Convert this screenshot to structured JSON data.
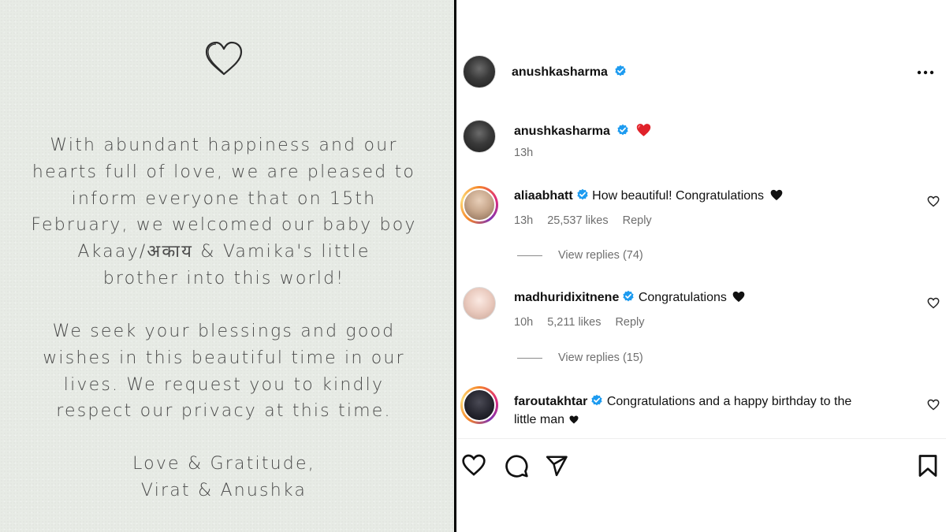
{
  "card": {
    "paragraph1": [
      "With abundant happiness and our",
      "hearts full of love, we are pleased to",
      "inform everyone that on 15th",
      "February, we welcomed our baby boy",
      "Akaay/अकाय & Vamika's little",
      "brother into this world!"
    ],
    "paragraph2": [
      "We seek your blessings and good",
      "wishes in this beautiful time in our",
      "lives. We request you to kindly",
      "respect our privacy at this time."
    ],
    "signoff": [
      "Love & Gratitude,",
      "Virat & Anushka"
    ]
  },
  "post": {
    "author": "anushkasharma",
    "caption_author": "anushkasharma",
    "caption_time": "13h",
    "accent_verified": "#1d9bf0"
  },
  "comments": [
    {
      "user": "aliaabhatt",
      "text": "How beautiful! Congratulations",
      "time": "13h",
      "likes": "25,537 likes",
      "reply": "Reply",
      "view_replies": "View replies (74)"
    },
    {
      "user": "madhuridixitnene",
      "text": "Congratulations",
      "time": "10h",
      "likes": "5,211 likes",
      "reply": "Reply",
      "view_replies": "View replies (15)"
    },
    {
      "user": "faroutakhtar",
      "text": "Congratulations and a happy birthday to the",
      "text_line2": "little man"
    }
  ],
  "icons": [
    "heart-icon",
    "more-options-icon",
    "verified-badge-icon",
    "comment-icon",
    "share-icon",
    "bookmark-icon"
  ]
}
